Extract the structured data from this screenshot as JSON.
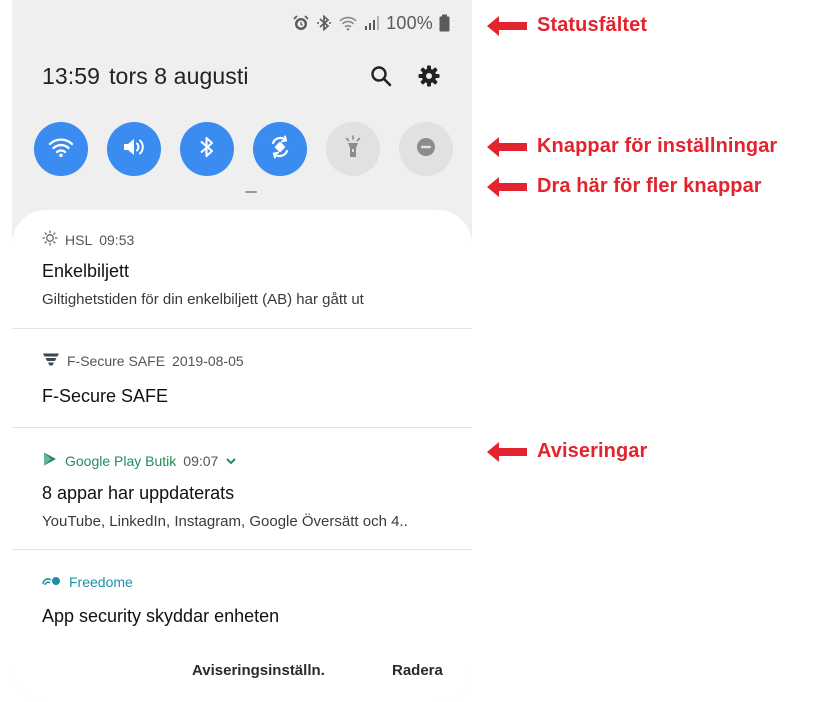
{
  "status": {
    "battery": "100%"
  },
  "header": {
    "time": "13:59",
    "date": "tors 8 augusti"
  },
  "quick_settings": [
    {
      "name": "wifi-icon",
      "state": "on"
    },
    {
      "name": "sound-icon",
      "state": "on"
    },
    {
      "name": "bluetooth-icon",
      "state": "on"
    },
    {
      "name": "auto-rotate-icon",
      "state": "on"
    },
    {
      "name": "flashlight-icon",
      "state": "off"
    },
    {
      "name": "do-not-disturb-icon",
      "state": "off"
    }
  ],
  "notifications": [
    {
      "app": "HSL",
      "time": "09:53",
      "title": "Enkelbiljett",
      "body": "Giltighetstiden för din enkelbiljett (AB) har gått ut"
    },
    {
      "app": "F-Secure SAFE",
      "time": "2019-08-05",
      "title": "F-Secure SAFE",
      "body": ""
    },
    {
      "app": "Google Play Butik",
      "time": "09:07",
      "title": "8 appar har uppdaterats",
      "body": "YouTube, LinkedIn, Instagram, Google Översätt och 4.."
    },
    {
      "app": "Freedome",
      "time": "",
      "title": "App security skyddar enheten",
      "body": ""
    }
  ],
  "actions": {
    "settings": "Aviseringsinställn.",
    "clear": "Radera"
  },
  "annotations": {
    "status_bar": "Statusfältet",
    "buttons": "Knappar för inställningar",
    "drag": "Dra här för fler knappar",
    "notifications": "Aviseringar"
  },
  "colors": {
    "accent": "#3b8cf0",
    "annotation": "#e3232d",
    "play_green": "#1e8e5a",
    "freedome_teal": "#1f8fa5"
  }
}
